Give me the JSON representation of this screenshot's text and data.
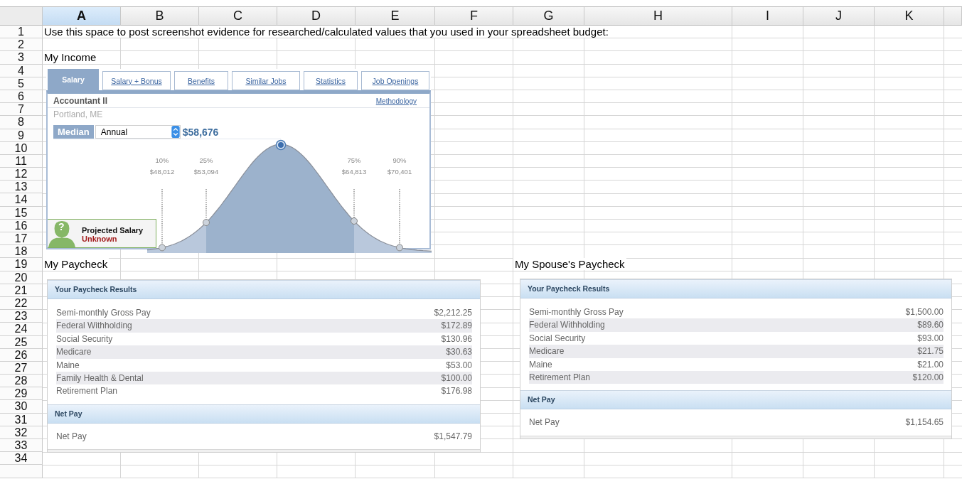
{
  "columns": [
    {
      "label": "A",
      "selected": true
    },
    {
      "label": "B",
      "selected": false
    },
    {
      "label": "C",
      "selected": false
    },
    {
      "label": "D",
      "selected": false
    },
    {
      "label": "E",
      "selected": false
    },
    {
      "label": "F",
      "selected": false
    },
    {
      "label": "G",
      "selected": false
    },
    {
      "label": "H",
      "selected": false
    },
    {
      "label": "I",
      "selected": false
    },
    {
      "label": "J",
      "selected": false
    },
    {
      "label": "K",
      "selected": false
    }
  ],
  "rows": [
    {
      "number": "1",
      "cells": {
        "A": "Use this space to post screenshot evidence for researched/calculated values that you used in your spreadsheet budget:"
      }
    },
    {
      "number": "2"
    },
    {
      "number": "3",
      "cells": {
        "A": "My Income"
      }
    },
    {
      "number": "4"
    },
    {
      "number": "5"
    },
    {
      "number": "6"
    },
    {
      "number": "7"
    },
    {
      "number": "8"
    },
    {
      "number": "9"
    },
    {
      "number": "10"
    },
    {
      "number": "11"
    },
    {
      "number": "12"
    },
    {
      "number": "13"
    },
    {
      "number": "14"
    },
    {
      "number": "15"
    },
    {
      "number": "16"
    },
    {
      "number": "17"
    },
    {
      "number": "18"
    },
    {
      "number": "19",
      "cells": {
        "A": "My Paycheck",
        "G": "My Spouse's Paycheck"
      }
    },
    {
      "number": "20"
    },
    {
      "number": "21"
    },
    {
      "number": "22"
    },
    {
      "number": "23"
    },
    {
      "number": "24"
    },
    {
      "number": "25"
    },
    {
      "number": "26"
    },
    {
      "number": "27"
    },
    {
      "number": "28"
    },
    {
      "number": "29"
    },
    {
      "number": "30"
    },
    {
      "number": "31"
    },
    {
      "number": "32"
    },
    {
      "number": "33"
    },
    {
      "number": "34"
    }
  ],
  "salary_widget": {
    "tabs": [
      {
        "label": "Salary",
        "selected": true
      },
      {
        "label": "Salary + Bonus",
        "selected": false
      },
      {
        "label": "Benefits",
        "selected": false
      },
      {
        "label": "Similar Jobs",
        "selected": false
      },
      {
        "label": "Statistics",
        "selected": false
      },
      {
        "label": "Job Openings",
        "selected": false
      }
    ],
    "title": "Accountant II",
    "link": "Methodology",
    "location": "Portland, ME",
    "median_label": "Median",
    "period": "Annual",
    "value": "$58,676",
    "percentiles": [
      {
        "percent": "10%",
        "amount": "$48,012"
      },
      {
        "percent": "25%",
        "amount": "$53,094"
      },
      {
        "percent": "75%",
        "amount": "$64,813"
      },
      {
        "percent": "90%",
        "amount": "$70,401"
      }
    ],
    "projected": {
      "badge": "?",
      "title": "Projected Salary",
      "status": "Unknown"
    }
  },
  "paychecks": [
    {
      "header": "Your Paycheck Results",
      "lines": [
        {
          "label": "Semi-monthly Gross Pay",
          "amount": "$2,212.25"
        },
        {
          "label": "Federal Withholding",
          "amount": "$172.89"
        },
        {
          "label": "Social Security",
          "amount": "$130.96"
        },
        {
          "label": "Medicare",
          "amount": "$30.63"
        },
        {
          "label": "Maine",
          "amount": "$53.00"
        },
        {
          "label": "Family Health & Dental",
          "amount": "$100.00"
        },
        {
          "label": "Retirement Plan",
          "amount": "$176.98"
        }
      ],
      "net_header": "Net Pay",
      "net": {
        "label": "Net Pay",
        "amount": "$1,547.79"
      }
    },
    {
      "header": "Your Paycheck Results",
      "lines": [
        {
          "label": "Semi-monthly Gross Pay",
          "amount": "$1,500.00"
        },
        {
          "label": "Federal Withholding",
          "amount": "$89.60"
        },
        {
          "label": "Social Security",
          "amount": "$93.00"
        },
        {
          "label": "Medicare",
          "amount": "$21.75"
        },
        {
          "label": "Maine",
          "amount": "$21.00"
        },
        {
          "label": "Retirement Plan",
          "amount": "$120.00"
        }
      ],
      "net_header": "Net Pay",
      "net": {
        "label": "Net Pay",
        "amount": "$1,154.65"
      }
    }
  ]
}
